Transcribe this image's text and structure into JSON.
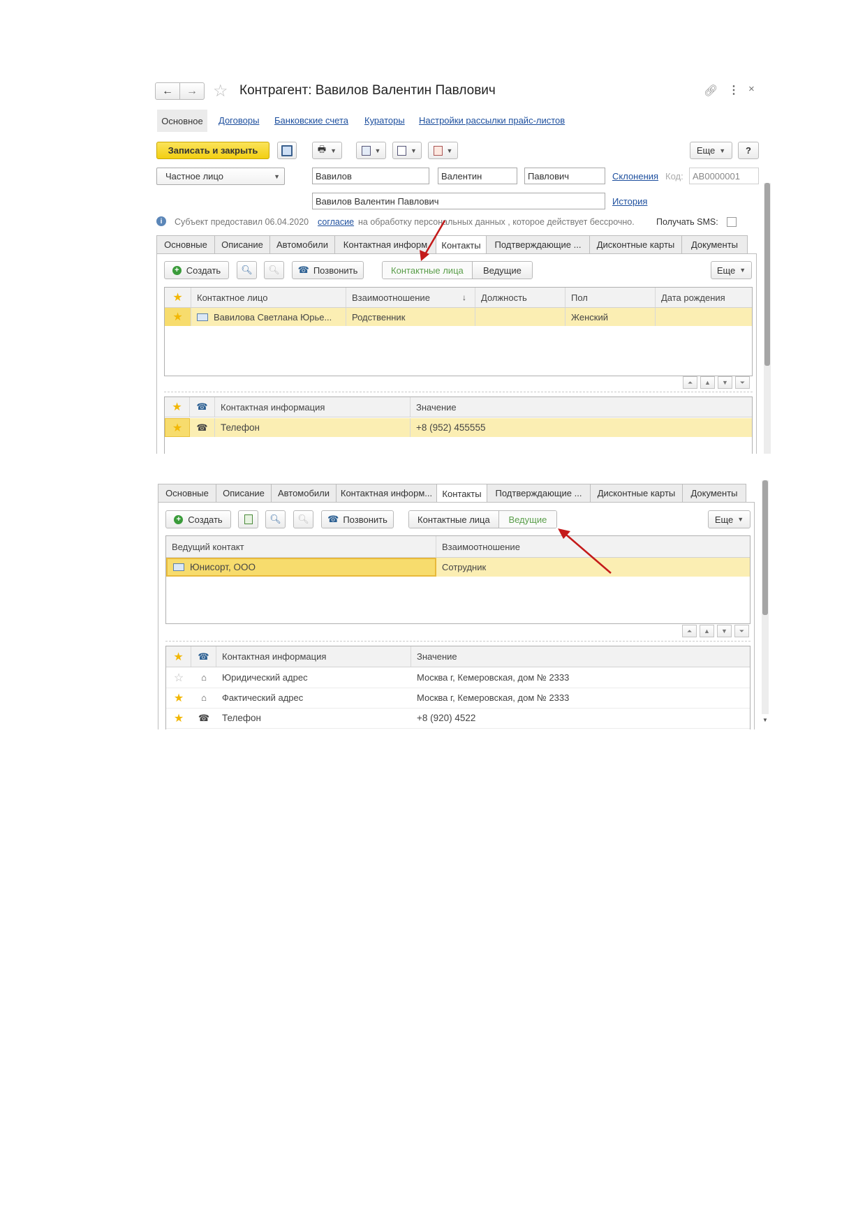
{
  "window": {
    "title": "Контрагент: Вавилов Валентин Павлович",
    "nav_back": "←",
    "nav_forward": "→"
  },
  "top_nav": {
    "active": "Основное",
    "links": [
      "Договоры",
      "Банковские счета",
      "Кураторы",
      "Настройки рассылки прайс-листов"
    ]
  },
  "toolbar": {
    "save_close": "Записать и закрыть",
    "more": "Еще",
    "help": "?"
  },
  "form": {
    "person_type": "Частное лицо",
    "last_name": "Вавилов",
    "first_name": "Валентин",
    "middle_name": "Павлович",
    "full_name": "Вавилов Валентин Павлович",
    "declensions_link": "Склонения",
    "code_label": "Код:",
    "code_value": "АВ0000001",
    "history_link": "История"
  },
  "consent": {
    "text_before": "Субъект предоставил 06.04.2020",
    "link": "согласие",
    "text_after": "на обработку персональных данных , которое действует бессрочно.",
    "sms_label": "Получать SMS:"
  },
  "tabs": [
    "Основные",
    "Описание",
    "Автомобили",
    "Контактная информ...",
    "Контакты",
    "Подтверждающие ...",
    "Дисконтные карты",
    "Документы"
  ],
  "tabs_top": [
    "Основные",
    "Описание",
    "Автомобили",
    "Контактная информ",
    "Контакты",
    "Подтверждающие ...",
    "Дисконтные карты",
    "Документы"
  ],
  "contacts_toolbar": {
    "create": "Создать",
    "call": "Позвонить",
    "toggle_persons": "Контактные лица",
    "toggle_leading": "Ведущие",
    "more": "Еще"
  },
  "persons_grid": {
    "headers": [
      "Контактное лицо",
      "Взаимоотношение",
      "Должность",
      "Пол",
      "Дата рождения"
    ],
    "sort_icon": "↓",
    "rows": [
      {
        "name": "Вавилова Светлана  Юрье...",
        "relation": "Родственник",
        "position": "",
        "gender": "Женский",
        "birth": ""
      }
    ]
  },
  "info_grid_top": {
    "headers": [
      "Контактная информация",
      "Значение"
    ],
    "rows": [
      {
        "type": "Телефон",
        "value": "+8 (952) 455555"
      }
    ]
  },
  "leading_grid": {
    "headers": [
      "Ведущий контакт",
      "Взаимоотношение"
    ],
    "rows": [
      {
        "name": "Юнисорт, ООО",
        "relation": "Сотрудник"
      }
    ]
  },
  "info_grid_bottom": {
    "headers": [
      "Контактная информация",
      "Значение"
    ],
    "rows": [
      {
        "type": "Юридический адрес",
        "value": "Москва г, Кемеровская, дом № 2333"
      },
      {
        "type": "Фактический адрес",
        "value": "Москва г, Кемеровская, дом № 2333"
      },
      {
        "type": "Телефон",
        "value": "+8 (920) 4522"
      }
    ]
  },
  "colors": {
    "accent_yellow": "#f7d81e",
    "selected_row": "#fbeeb3",
    "link_blue": "#1d4f9e",
    "toggle_active_text": "#5a9e4a",
    "annotation_arrow": "#c41a1a"
  }
}
